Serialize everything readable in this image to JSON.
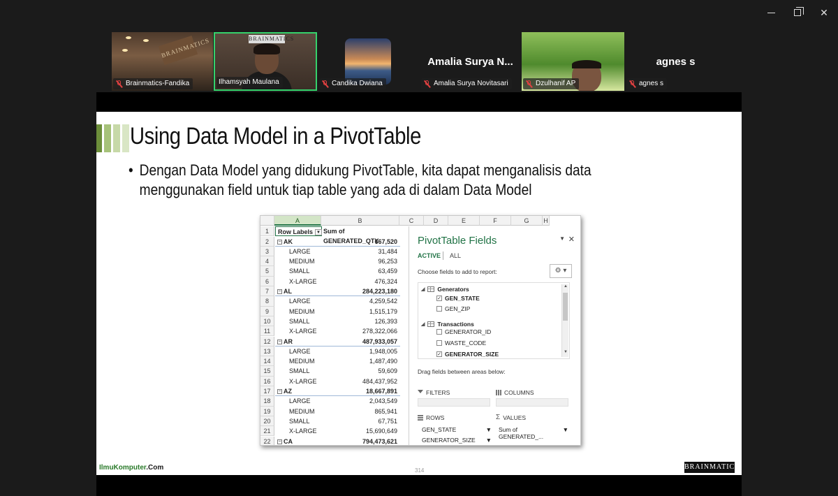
{
  "participants": [
    {
      "name": "Brainmatics-Fandika",
      "muted": true,
      "kind": "video"
    },
    {
      "name": "Ilhamsyah Maulana",
      "muted": false,
      "kind": "video",
      "active_speaker": true
    },
    {
      "name": "Candika Dwiana",
      "muted": true,
      "kind": "avatar"
    },
    {
      "name": "Amalia Surya Novitasari",
      "display": "Amalia Surya N...",
      "muted": true,
      "kind": "name"
    },
    {
      "name": "Dzulhanif AP",
      "muted": true,
      "kind": "video"
    },
    {
      "name": "agnes s",
      "display": "agnes s",
      "muted": true,
      "kind": "name"
    }
  ],
  "tile_signs": {
    "office_sign": "BRAINMATICS",
    "brand_strip": "BRAINMATICS"
  },
  "slide": {
    "title": "Using Data Model in a PivotTable",
    "bullet_line1": "Dengan Data Model yang didukung PivotTable, kita dapat menganalisis data",
    "bullet_line2": "menggunakan field untuk tiap table yang ada di dalam Data Model",
    "footer_left_a": "IlmuKomputer",
    "footer_left_b": ".Com",
    "page_number": "314",
    "footer_logo": "BRAINMATICS"
  },
  "excel": {
    "columns": [
      "A",
      "B",
      "C",
      "D",
      "E",
      "F",
      "G",
      "H"
    ],
    "header": {
      "row_labels": "Row Labels",
      "sum_label": "Sum of GENERATED_QTY"
    },
    "rows": [
      {
        "n": "2",
        "label": "AK",
        "value": "667,520",
        "state": true
      },
      {
        "n": "3",
        "label": "LARGE",
        "value": "31,484"
      },
      {
        "n": "4",
        "label": "MEDIUM",
        "value": "96,253"
      },
      {
        "n": "5",
        "label": "SMALL",
        "value": "63,459"
      },
      {
        "n": "6",
        "label": "X-LARGE",
        "value": "476,324"
      },
      {
        "n": "7",
        "label": "AL",
        "value": "284,223,180",
        "state": true
      },
      {
        "n": "8",
        "label": "LARGE",
        "value": "4,259,542"
      },
      {
        "n": "9",
        "label": "MEDIUM",
        "value": "1,515,179"
      },
      {
        "n": "10",
        "label": "SMALL",
        "value": "126,393"
      },
      {
        "n": "11",
        "label": "X-LARGE",
        "value": "278,322,066"
      },
      {
        "n": "12",
        "label": "AR",
        "value": "487,933,057",
        "state": true
      },
      {
        "n": "13",
        "label": "LARGE",
        "value": "1,948,005"
      },
      {
        "n": "14",
        "label": "MEDIUM",
        "value": "1,487,490"
      },
      {
        "n": "15",
        "label": "SMALL",
        "value": "59,609"
      },
      {
        "n": "16",
        "label": "X-LARGE",
        "value": "484,437,952"
      },
      {
        "n": "17",
        "label": "AZ",
        "value": "18,667,891",
        "state": true
      },
      {
        "n": "18",
        "label": "LARGE",
        "value": "2,043,549"
      },
      {
        "n": "19",
        "label": "MEDIUM",
        "value": "865,941"
      },
      {
        "n": "20",
        "label": "SMALL",
        "value": "67,751"
      },
      {
        "n": "21",
        "label": "X-LARGE",
        "value": "15,690,649"
      },
      {
        "n": "22",
        "label": "CA",
        "value": "794,473,621",
        "state": true
      }
    ]
  },
  "pivot": {
    "title": "PivotTable Fields",
    "tab_active": "ACTIVE",
    "tab_all": "ALL",
    "choose_label": "Choose fields to add to report:",
    "groups": [
      {
        "name": "Generators",
        "fields": [
          {
            "name": "GEN_STATE",
            "checked": true
          },
          {
            "name": "GEN_ZIP",
            "checked": false
          }
        ]
      },
      {
        "name": "Transactions",
        "fields": [
          {
            "name": "GENERATOR_ID",
            "checked": false
          },
          {
            "name": "WASTE_CODE",
            "checked": false
          },
          {
            "name": "GENERATOR_SIZE",
            "checked": true
          }
        ]
      }
    ],
    "drag_label": "Drag fields between areas below:",
    "areas": {
      "filters": "FILTERS",
      "columns": "COLUMNS",
      "rows": "ROWS",
      "values": "VALUES"
    },
    "row_fields": [
      "GEN_STATE",
      "GENERATOR_SIZE"
    ],
    "value_fields": [
      "Sum of GENERATED_..."
    ]
  }
}
